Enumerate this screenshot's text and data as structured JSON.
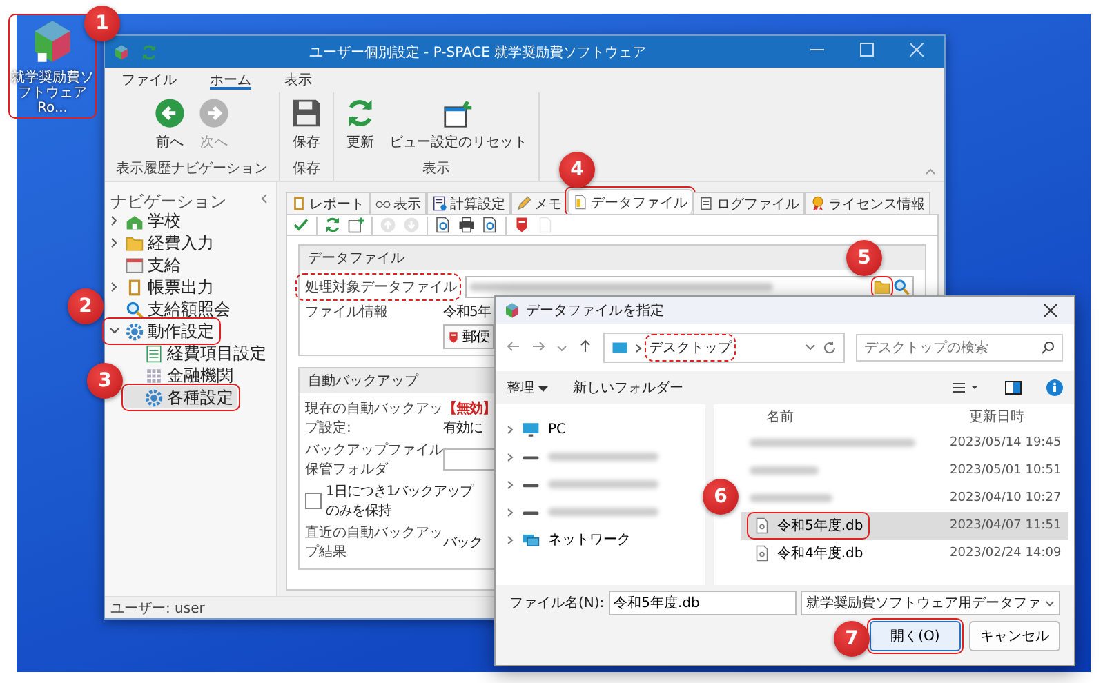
{
  "desktop_icon": {
    "label": "就学奨励費ソフトウェア Ro..."
  },
  "callouts": [
    {
      "number": "1"
    },
    {
      "number": "2"
    },
    {
      "number": "3"
    },
    {
      "number": "4"
    },
    {
      "number": "5"
    },
    {
      "number": "6"
    },
    {
      "number": "7"
    }
  ],
  "main_window": {
    "title": "ユーザー個別設定 - P-SPACE 就学奨励費ソフトウェア",
    "menu_tabs": [
      {
        "label": "ファイル",
        "selected": false
      },
      {
        "label": "ホーム",
        "selected": true
      },
      {
        "label": "表示",
        "selected": false
      }
    ],
    "ribbon_groups": [
      {
        "label": "表示履歴ナビゲーション",
        "buttons": [
          {
            "label": "前へ",
            "kind": "back",
            "disabled": false
          },
          {
            "label": "次へ",
            "kind": "forward",
            "disabled": true
          }
        ]
      },
      {
        "label": "保存",
        "buttons": [
          {
            "label": "保存",
            "kind": "save",
            "disabled": false
          }
        ]
      },
      {
        "label": "表示",
        "buttons": [
          {
            "label": "更新",
            "kind": "refresh",
            "disabled": false
          },
          {
            "label": "ビュー設定のリセット",
            "kind": "reset",
            "disabled": false
          }
        ]
      }
    ],
    "navigation": {
      "title": "ナビゲーション",
      "items": [
        {
          "label": "学校",
          "kind": "school",
          "expanded": false,
          "selected": false
        },
        {
          "label": "経費入力",
          "kind": "folder",
          "expanded": false,
          "selected": false
        },
        {
          "label": "支給",
          "kind": "calendar",
          "selected": false
        },
        {
          "label": "帳票出力",
          "kind": "book",
          "expanded": false,
          "selected": false
        },
        {
          "label": "支給額照会",
          "kind": "search",
          "selected": false
        },
        {
          "label": "動作設定",
          "kind": "gear",
          "expanded": true,
          "selected": false,
          "children": [
            {
              "label": "経費項目設定",
              "kind": "sheet",
              "selected": false
            },
            {
              "label": "金融機関",
              "kind": "grid",
              "selected": false
            },
            {
              "label": "各種設定",
              "kind": "gear",
              "selected": true
            }
          ]
        }
      ]
    },
    "tabs": [
      {
        "label": "レポート",
        "kind": "report",
        "selected": false
      },
      {
        "label": "表示",
        "kind": "glasses",
        "selected": false
      },
      {
        "label": "計算設定",
        "kind": "calc",
        "selected": false
      },
      {
        "label": "メモ",
        "kind": "pencil",
        "selected": false
      },
      {
        "label": "データファイル",
        "kind": "doc",
        "selected": true
      },
      {
        "label": "ログファイル",
        "kind": "log",
        "selected": false
      },
      {
        "label": "ライセンス情報",
        "kind": "award",
        "selected": false
      }
    ],
    "toolbar": [
      {
        "kind": "check",
        "disabled": false
      },
      {
        "kind": "refresh",
        "disabled": false
      },
      {
        "kind": "new",
        "disabled": false
      },
      {
        "kind": "up",
        "disabled": true
      },
      {
        "kind": "down",
        "disabled": true
      },
      {
        "kind": "preview",
        "disabled": false
      },
      {
        "kind": "print",
        "disabled": false
      },
      {
        "kind": "preview",
        "disabled": false
      },
      {
        "kind": "pdf",
        "disabled": false
      },
      {
        "kind": "page",
        "disabled": true
      }
    ],
    "data_file_section": {
      "heading": "データファイル",
      "target_label": "処理対象データファイル",
      "info_label": "ファイル情報",
      "info_value": "令和5年",
      "info_button": "郵便"
    },
    "backup_section": {
      "heading": "自動バックアップ",
      "current_label": "現在の自動バックアップ設定:",
      "current_status": "【無効】",
      "enable_link": "有効に",
      "folder_label": "バックアップファイル保管フォルダ",
      "keep_one": {
        "label": "1日につき1バックアップのみを保持",
        "checked": false
      },
      "last_label": "直近の自動バックアップ結果",
      "last_value": "バック"
    },
    "status_bar": "ユーザー: user"
  },
  "dialog": {
    "title": "データファイルを指定",
    "address": {
      "location": "デスクトップ"
    },
    "search": {
      "placeholder": "デスクトップの検索"
    },
    "toolbar": {
      "organize": "整理",
      "new_folder": "新しいフォルダー"
    },
    "nav_items": [
      {
        "kind": "pc",
        "label": "PC"
      },
      {
        "kind": "drive"
      },
      {
        "kind": "drive"
      },
      {
        "kind": "drive"
      },
      {
        "kind": "network",
        "label": "ネットワーク"
      }
    ],
    "columns": [
      "名前",
      "更新日時"
    ],
    "files": [
      {
        "kind": "blurred",
        "modified": "2023/05/14 19:45",
        "selected": false
      },
      {
        "kind": "blurred",
        "modified": "2023/05/01 10:51",
        "selected": false
      },
      {
        "kind": "blurred",
        "modified": "2023/04/10 10:27",
        "selected": false
      },
      {
        "kind": "db",
        "name": "令和5年度.db",
        "modified": "2023/04/07 11:51",
        "selected": true
      },
      {
        "kind": "db",
        "name": "令和4年度.db",
        "modified": "2023/02/24 14:09",
        "selected": false
      }
    ],
    "filename_label": "ファイル名(N):",
    "filename": "令和5年度.db",
    "filter": "就学奨励費ソフトウェア用データファ",
    "buttons": [
      "開く(O)",
      "キャンセル"
    ]
  }
}
